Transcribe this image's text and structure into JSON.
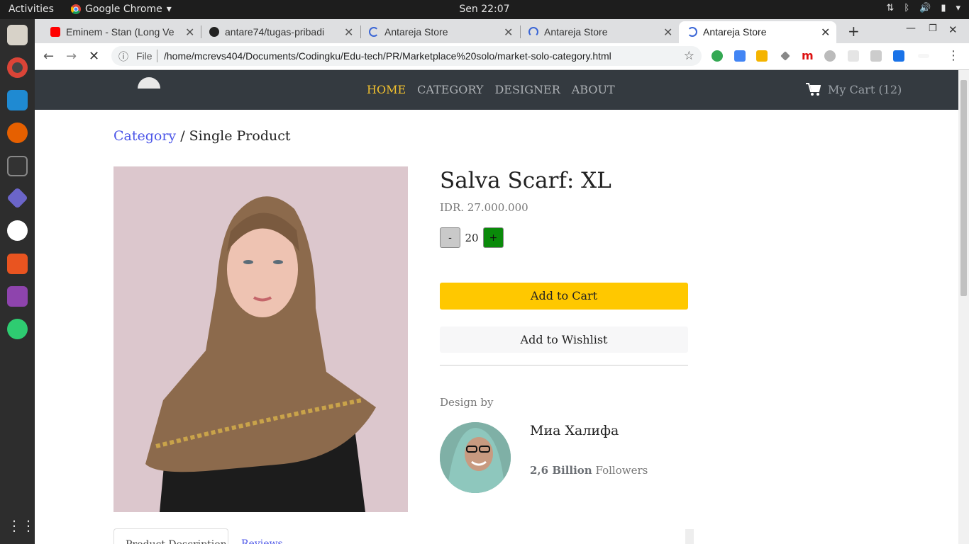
{
  "topbar": {
    "activities": "Activities",
    "app_name": "Google Chrome",
    "clock": "Sen 22:07"
  },
  "tabs": [
    {
      "title": "Eminem - Stan (Long Ve",
      "icon": "youtube-icon"
    },
    {
      "title": "antare74/tugas-pribadi",
      "icon": "github-icon"
    },
    {
      "title": "Antareja Store",
      "icon": "loading-icon"
    },
    {
      "title": "Antareja Store",
      "icon": "loading-icon"
    },
    {
      "title": "Antareja Store",
      "icon": "loading-icon"
    }
  ],
  "omnibox": {
    "scheme_label": "File",
    "url": "/home/mcrevs404/Documents/Codingku/Edu-tech/PR/Marketplace%20solo/market-solo-category.html"
  },
  "navbar": {
    "menu": [
      "HOME",
      "CATEGORY",
      "DESIGNER",
      "ABOUT"
    ],
    "cart_label": "My Cart (12)",
    "active": "HOME"
  },
  "breadcrumb": {
    "link": "Category",
    "separator": " / ",
    "current": "Single Product"
  },
  "product": {
    "title": "Salva Scarf: XL",
    "price": "IDR. 27.000.000",
    "quantity": "20",
    "minus_label": "-",
    "plus_label": "+",
    "add_to_cart": "Add to Cart",
    "add_to_wishlist": "Add to Wishlist"
  },
  "designer": {
    "label": "Design by",
    "name": "Миа Халифа",
    "followers_count": "2,6 Billion",
    "followers_label": "Followers"
  },
  "product_tabs": [
    "Product Description",
    "Reviews"
  ],
  "colors": {
    "navbar_bg": "#343a40",
    "active_menu": "#f2c12e",
    "add_to_cart_bg": "#ffc800",
    "plus_btn": "#0a8a0a",
    "link": "#4c56e8"
  }
}
